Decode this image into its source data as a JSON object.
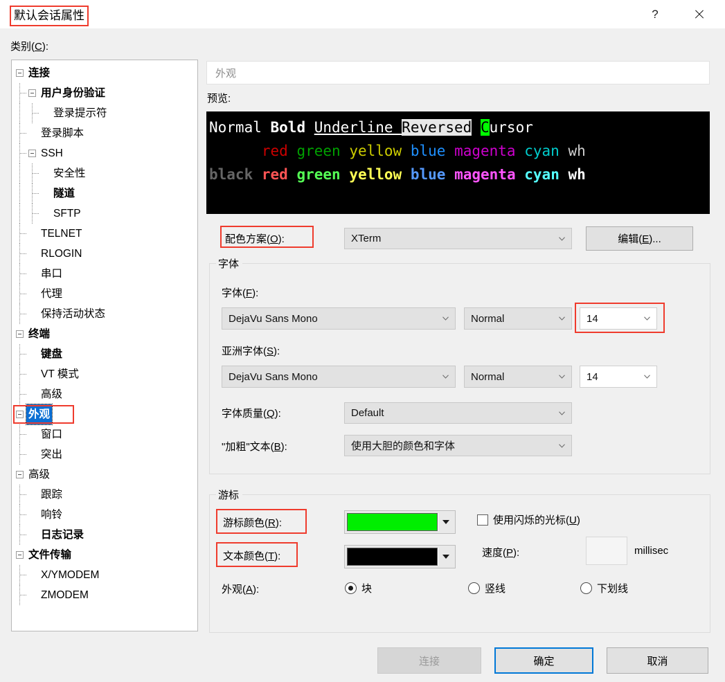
{
  "window": {
    "title": "默认会话属性",
    "help_label": "?",
    "close_label": "✕"
  },
  "category": {
    "label": "类别(C):",
    "accesskey": "C",
    "tree": [
      {
        "label": "连接",
        "level": 0,
        "bold": true,
        "expander": true,
        "selected": false
      },
      {
        "label": "用户身份验证",
        "level": 1,
        "bold": true,
        "expander": true,
        "selected": false
      },
      {
        "label": "登录提示符",
        "level": 2,
        "bold": false,
        "expander": false,
        "selected": false
      },
      {
        "label": "登录脚本",
        "level": 1,
        "bold": false,
        "expander": false,
        "selected": false
      },
      {
        "label": "SSH",
        "level": 1,
        "bold": false,
        "expander": true,
        "selected": false
      },
      {
        "label": "安全性",
        "level": 2,
        "bold": false,
        "expander": false,
        "selected": false
      },
      {
        "label": "隧道",
        "level": 2,
        "bold": true,
        "expander": false,
        "selected": false
      },
      {
        "label": "SFTP",
        "level": 2,
        "bold": false,
        "expander": false,
        "selected": false
      },
      {
        "label": "TELNET",
        "level": 1,
        "bold": false,
        "expander": false,
        "selected": false
      },
      {
        "label": "RLOGIN",
        "level": 1,
        "bold": false,
        "expander": false,
        "selected": false
      },
      {
        "label": "串口",
        "level": 1,
        "bold": false,
        "expander": false,
        "selected": false
      },
      {
        "label": "代理",
        "level": 1,
        "bold": false,
        "expander": false,
        "selected": false
      },
      {
        "label": "保持活动状态",
        "level": 1,
        "bold": false,
        "expander": false,
        "selected": false
      },
      {
        "label": "终端",
        "level": 0,
        "bold": true,
        "expander": true,
        "selected": false
      },
      {
        "label": "键盘",
        "level": 1,
        "bold": true,
        "expander": false,
        "selected": false
      },
      {
        "label": "VT 模式",
        "level": 1,
        "bold": false,
        "expander": false,
        "selected": false
      },
      {
        "label": "高级",
        "level": 1,
        "bold": false,
        "expander": false,
        "selected": false
      },
      {
        "label": "外观",
        "level": 0,
        "bold": true,
        "expander": true,
        "selected": true
      },
      {
        "label": "窗口",
        "level": 1,
        "bold": false,
        "expander": false,
        "selected": false
      },
      {
        "label": "突出",
        "level": 1,
        "bold": false,
        "expander": false,
        "selected": false
      },
      {
        "label": "高级",
        "level": 0,
        "bold": false,
        "expander": true,
        "selected": false
      },
      {
        "label": "跟踪",
        "level": 1,
        "bold": false,
        "expander": false,
        "selected": false
      },
      {
        "label": "响铃",
        "level": 1,
        "bold": false,
        "expander": false,
        "selected": false
      },
      {
        "label": "日志记录",
        "level": 1,
        "bold": true,
        "expander": false,
        "selected": false
      },
      {
        "label": "文件传输",
        "level": 0,
        "bold": true,
        "expander": true,
        "selected": false
      },
      {
        "label": "X/YMODEM",
        "level": 1,
        "bold": false,
        "expander": false,
        "selected": false
      },
      {
        "label": "ZMODEM",
        "level": 1,
        "bold": false,
        "expander": false,
        "selected": false
      }
    ]
  },
  "page": {
    "header_title": "外观",
    "preview_label": "预览:",
    "preview": {
      "line1": [
        {
          "text": "Normal ",
          "style": "normal",
          "color": "#ffffff"
        },
        {
          "text": "Bold ",
          "style": "bold",
          "color": "#ffffff"
        },
        {
          "text": "Underline ",
          "style": "underline",
          "color": "#ffffff"
        },
        {
          "text": "Reversed",
          "style": "reversed",
          "color": "#000000"
        },
        {
          "text": " ",
          "style": "normal",
          "color": "#ffffff"
        },
        {
          "text": "C",
          "style": "cursor",
          "color": "#000000"
        },
        {
          "text": "ursor",
          "style": "normal",
          "color": "#ffffff"
        }
      ],
      "line2_indent": "      ",
      "line2": [
        {
          "text": "red",
          "color": "#cd0000"
        },
        {
          "text": "green",
          "color": "#00a000"
        },
        {
          "text": "yellow",
          "color": "#cdcd00"
        },
        {
          "text": "blue",
          "color": "#1e90ff"
        },
        {
          "text": "magenta",
          "color": "#cd00cd"
        },
        {
          "text": "cyan",
          "color": "#00cdcd"
        },
        {
          "text": "wh",
          "color": "#d0d0d0"
        }
      ],
      "line3": [
        {
          "text": "black",
          "color": "#666666"
        },
        {
          "text": "red",
          "color": "#ff5555"
        },
        {
          "text": "green",
          "color": "#55ff55"
        },
        {
          "text": "yellow",
          "color": "#ffff55"
        },
        {
          "text": "blue",
          "color": "#5599ff"
        },
        {
          "text": "magenta",
          "color": "#ff55ff"
        },
        {
          "text": "cyan",
          "color": "#55ffff"
        },
        {
          "text": "wh",
          "color": "#ffffff"
        }
      ]
    },
    "color_scheme": {
      "label": "配色方案(O):",
      "value": "XTerm",
      "edit_button": "编辑(E)..."
    },
    "font_group": {
      "title": "字体",
      "font_label": "字体(F):",
      "font_value": "DejaVu Sans Mono",
      "font_style": "Normal",
      "font_size": "14",
      "asian_label": "亚洲字体(S):",
      "asian_value": "DejaVu Sans Mono",
      "asian_style": "Normal",
      "asian_size": "14",
      "quality_label": "字体质量(Q):",
      "quality_value": "Default",
      "bold_label": "\"加粗\"文本(B):",
      "bold_value": "使用大胆的颜色和字体"
    },
    "cursor_group": {
      "title": "游标",
      "cursor_color_label": "游标颜色(R):",
      "cursor_color_value": "#00ee00",
      "text_color_label": "文本颜色(T):",
      "text_color_value": "#000000",
      "blink_label": "使用闪烁的光标(U)",
      "blink_checked": false,
      "speed_label": "速度(P):",
      "speed_value": "",
      "speed_unit": "millisec",
      "appearance_label": "外观(A):",
      "options": [
        {
          "label": "块",
          "selected": true
        },
        {
          "label": "竖线",
          "selected": false
        },
        {
          "label": "下划线",
          "selected": false
        }
      ]
    }
  },
  "footer": {
    "connect_label": "连接",
    "connect_disabled": true,
    "ok_label": "确定",
    "cancel_label": "取消"
  },
  "annotations": {
    "accent": "#ef3b2d"
  }
}
